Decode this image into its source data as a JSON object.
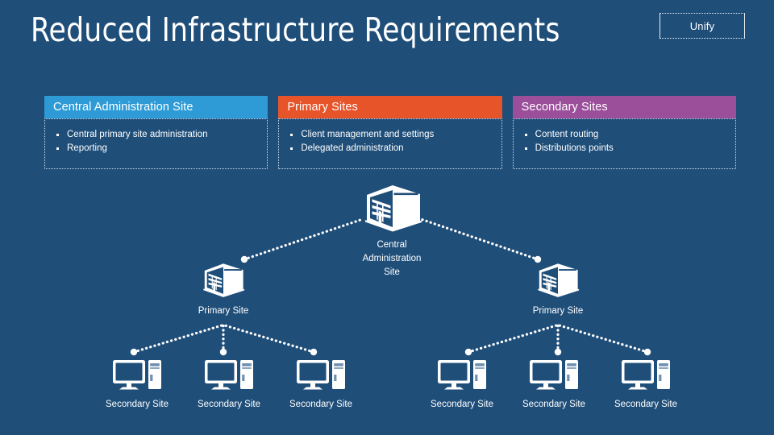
{
  "slide": {
    "background_color": "#1F4E79",
    "title": "Reduced Infrastructure Requirements"
  },
  "stamp": {
    "label": "Unify"
  },
  "cards": [
    {
      "header": "Central Administration Site",
      "header_color": "#2E9BD6",
      "bullets": [
        "Central primary site administration",
        "Reporting"
      ]
    },
    {
      "header": "Primary Sites",
      "header_color": "#E8542A",
      "bullets": [
        "Client management and settings",
        "Delegated administration"
      ]
    },
    {
      "header": "Secondary Sites",
      "header_color": "#9B4F9B",
      "bullets": [
        "Content routing",
        "Distributions points"
      ]
    }
  ],
  "diagram": {
    "connector_color": "#ffffff",
    "central": {
      "label": "Central\nAdministration\nSite",
      "icon": "datacenter-building-icon"
    },
    "primary_sites": [
      {
        "label": "Primary Site",
        "icon": "datacenter-building-icon"
      },
      {
        "label": "Primary Site",
        "icon": "datacenter-building-icon"
      }
    ],
    "secondary_sites": [
      {
        "label": "Secondary Site",
        "icon": "desktop-computer-icon"
      },
      {
        "label": "Secondary Site",
        "icon": "desktop-computer-icon"
      },
      {
        "label": "Secondary Site",
        "icon": "desktop-computer-icon"
      },
      {
        "label": "Secondary Site",
        "icon": "desktop-computer-icon"
      },
      {
        "label": "Secondary Site",
        "icon": "desktop-computer-icon"
      },
      {
        "label": "Secondary Site",
        "icon": "desktop-computer-icon"
      }
    ]
  }
}
